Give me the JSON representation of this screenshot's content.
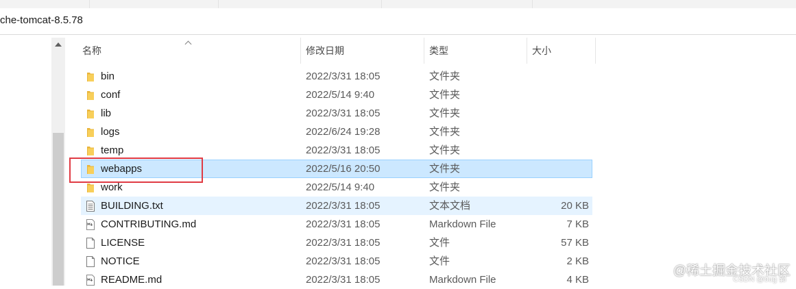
{
  "address_bar": {
    "path_text": "che-tomcat-8.5.78"
  },
  "columns": {
    "name": "名称",
    "date": "修改日期",
    "type": "类型",
    "size": "大小"
  },
  "files": [
    {
      "name": "bin",
      "date": "2022/3/31 18:05",
      "type": "文件夹",
      "size": "",
      "icon": "folder-icon"
    },
    {
      "name": "conf",
      "date": "2022/5/14 9:40",
      "type": "文件夹",
      "size": "",
      "icon": "folder-icon"
    },
    {
      "name": "lib",
      "date": "2022/3/31 18:05",
      "type": "文件夹",
      "size": "",
      "icon": "folder-icon"
    },
    {
      "name": "logs",
      "date": "2022/6/24 19:28",
      "type": "文件夹",
      "size": "",
      "icon": "folder-icon"
    },
    {
      "name": "temp",
      "date": "2022/3/31 18:05",
      "type": "文件夹",
      "size": "",
      "icon": "folder-icon"
    },
    {
      "name": "webapps",
      "date": "2022/5/16 20:50",
      "type": "文件夹",
      "size": "",
      "icon": "folder-icon",
      "state": "selected"
    },
    {
      "name": "work",
      "date": "2022/5/14 9:40",
      "type": "文件夹",
      "size": "",
      "icon": "folder-icon"
    },
    {
      "name": "BUILDING.txt",
      "date": "2022/3/31 18:05",
      "type": "文本文档",
      "size": "20 KB",
      "icon": "text-file-icon",
      "state": "hover"
    },
    {
      "name": "CONTRIBUTING.md",
      "date": "2022/3/31 18:05",
      "type": "Markdown File",
      "size": "7 KB",
      "icon": "markdown-file-icon"
    },
    {
      "name": "LICENSE",
      "date": "2022/3/31 18:05",
      "type": "文件",
      "size": "57 KB",
      "icon": "blank-file-icon"
    },
    {
      "name": "NOTICE",
      "date": "2022/3/31 18:05",
      "type": "文件",
      "size": "2 KB",
      "icon": "blank-file-icon"
    },
    {
      "name": "README.md",
      "date": "2022/3/31 18:05",
      "type": "Markdown File",
      "size": "4 KB",
      "icon": "markdown-file-icon"
    }
  ],
  "watermark": {
    "text": "@稀土掘金技术社区",
    "subtext": "CSDN @bug 郭"
  },
  "colors": {
    "selected_bg": "#cce8ff",
    "selected_border": "#99d1ff",
    "hover_bg": "#e5f3ff",
    "annotation_red": "#e03a43",
    "folder": "#f5c342"
  }
}
